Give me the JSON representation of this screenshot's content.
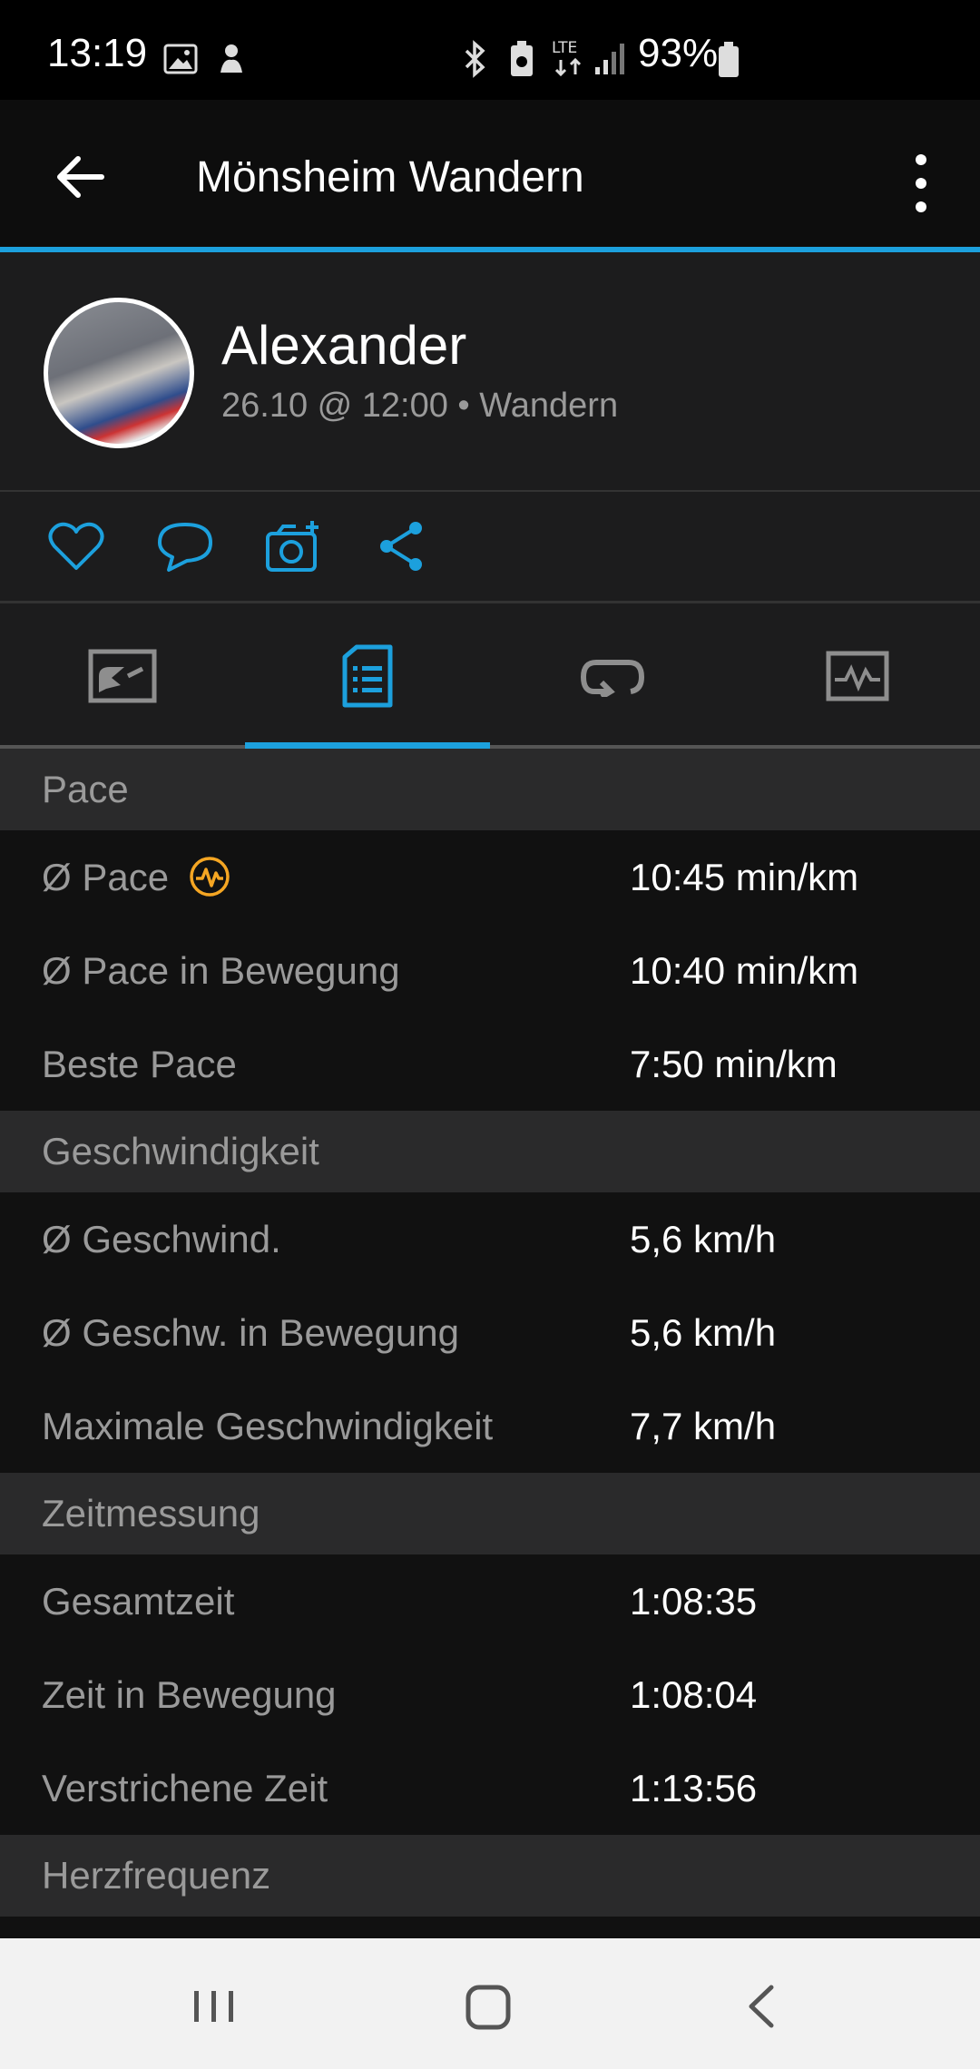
{
  "status_bar": {
    "time": "13:19",
    "battery_percent": "93%",
    "network_label": "LTE",
    "icons": [
      "gallery-icon",
      "notification-app-icon",
      "bluetooth-icon",
      "battery-saver-icon",
      "lte-icon",
      "signal-icon",
      "battery-icon"
    ]
  },
  "app_bar": {
    "title": "Mönsheim Wandern",
    "back_icon": "arrow-left-icon",
    "menu_icon": "more-vertical-icon"
  },
  "profile": {
    "name": "Alexander",
    "meta": "26.10 @ 12:00 • Wandern"
  },
  "actions": [
    {
      "name": "like",
      "icon": "heart-icon"
    },
    {
      "name": "comment",
      "icon": "comment-icon"
    },
    {
      "name": "add-photo",
      "icon": "camera-plus-icon"
    },
    {
      "name": "share",
      "icon": "share-icon"
    }
  ],
  "tabs": [
    {
      "id": "overview",
      "icon": "map-chart-icon",
      "active": false
    },
    {
      "id": "stats",
      "icon": "document-list-icon",
      "active": true
    },
    {
      "id": "laps",
      "icon": "loop-icon",
      "active": false
    },
    {
      "id": "charts",
      "icon": "activity-graph-icon",
      "active": false
    }
  ],
  "sections": {
    "pace": {
      "title": "Pace",
      "rows": [
        {
          "label": "Ø Pace",
          "value": "10:45 min/km"
        },
        {
          "label": "Ø Pace in Bewegung",
          "value": "10:40 min/km"
        },
        {
          "label": "Beste Pace",
          "value": "7:50 min/km"
        }
      ]
    },
    "speed": {
      "title": "Geschwindigkeit",
      "rows": [
        {
          "label": "Ø Geschwind.",
          "value": "5,6 km/h"
        },
        {
          "label": "Ø Geschw. in Bewegung",
          "value": "5,6 km/h"
        },
        {
          "label": "Maximale Geschwindigkeit",
          "value": "7,7 km/h"
        }
      ]
    },
    "time": {
      "title": "Zeitmessung",
      "rows": [
        {
          "label": "Gesamtzeit",
          "value": "1:08:35"
        },
        {
          "label": "Zeit in Bewegung",
          "value": "1:08:04"
        },
        {
          "label": "Verstrichene Zeit",
          "value": "1:13:56"
        }
      ]
    },
    "heart_rate": {
      "title": "Herzfrequenz"
    }
  },
  "colors": {
    "accent": "#1ca0dd",
    "highlight_icon": "#f5a623",
    "background": "#111111",
    "section_header": "#2a2a2b"
  },
  "nav_bar": {
    "buttons": [
      "recents-icon",
      "home-icon",
      "back-icon"
    ]
  }
}
